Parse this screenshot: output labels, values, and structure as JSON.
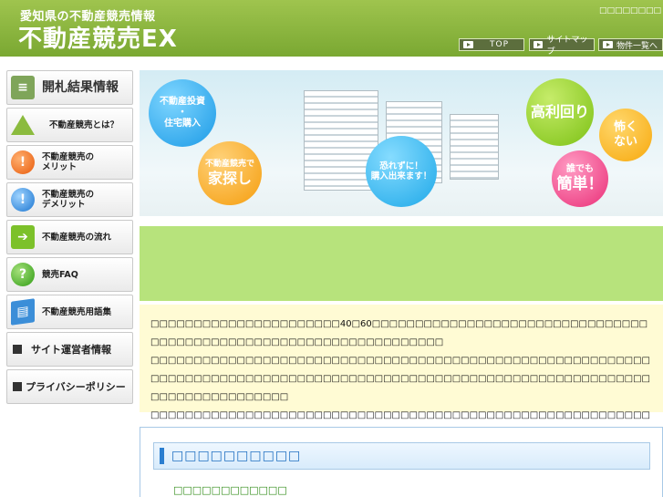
{
  "header": {
    "tagline": "愛知県の不動産競売情報",
    "logo": "不動産競売EX",
    "top_right": "□□□□□□□□",
    "nav": [
      {
        "label": "TOP"
      },
      {
        "label": "サイトマップ"
      },
      {
        "label": "物件一覧へ"
      }
    ]
  },
  "sidebar": {
    "items": [
      {
        "label": "開札結果情報",
        "icon": "document-icon"
      },
      {
        "label": "不動産競売とは？",
        "icon": "house-question-icon"
      },
      {
        "label": "不動産競売の\nメリット",
        "icon": "exclamation-icon"
      },
      {
        "label": "不動産競売の\nデメリット",
        "icon": "exclamation-icon"
      },
      {
        "label": "不動産競売の流れ",
        "icon": "arrow-right-icon"
      },
      {
        "label": "競売FAQ",
        "icon": "question-icon"
      },
      {
        "label": "不動産競売用語集",
        "icon": "book-icon"
      },
      {
        "label": "サイト運営者情報",
        "icon": "square-icon"
      },
      {
        "label": "プライバシーポリシー",
        "icon": "square-icon"
      }
    ]
  },
  "banner": {
    "bubble1": "不動産投資\n・\n住宅購入",
    "bubble2_small": "不動産競売で",
    "bubble2_big": "家探し",
    "bubble3": "恐れずに！\n購入出来ます！",
    "bubble4": "高利回り",
    "bubble5": "怖く\nない",
    "bubble6_small": "誰でも",
    "bubble6_big": "簡単！"
  },
  "intro": {
    "p1": "□□□□□□□□□□□□□□□□□□□□□□40□60□□□□□□□□□□□□□□□□□□□□□□□□□□□□□□□□□□□□□□□□□□□□□□□□□□□□□□□□□□□□□□□□□□",
    "p2": "□□□□□□□□□□□□□□□□□□□□□□□□□□□□□□□□□□□□□□□□□□□□□□□□□□□□□□□□□□□□□□□□□□□□□□□□□□□□□□□□□□□□□□□□□□□□□□□□□□□□□□□□□□□□□□□□□□□□□□□□□□□□□□□□□□□□",
    "p3": "□□□□□□□□□□□□□□□□□□□□□□□□□□□□□□□□□□□□□□□□□□□□□□□□□□□□□□□□□□□□□□□□□□□□□□□□□□□□□□□□□□□□□□□□□□□□□□□□□□□□□□□□□□□□□□□□□□□□□□□□□□□□□□"
  },
  "panel": {
    "title": "□□□□□□□□□□",
    "link": "□□□□□□□□□□□□"
  },
  "colors": {
    "header_green": "#8ab440",
    "accent_blue": "#2a7ed0",
    "yellow_bg": "#fffbd4",
    "green_bar": "#b7e37c"
  }
}
